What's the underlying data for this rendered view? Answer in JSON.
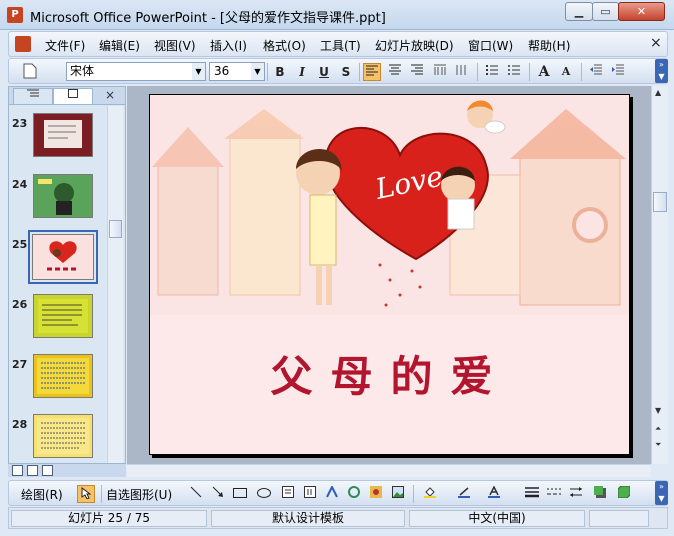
{
  "window": {
    "title": "Microsoft Office PowerPoint - [父母的爱作文指导课件.ppt]",
    "app_icon": "powerpoint-icon",
    "min_symbol": "▁",
    "max_symbol": "▭",
    "close_symbol": "✕"
  },
  "menu": {
    "items": [
      "文件(F)",
      "编辑(E)",
      "视图(V)",
      "插入(I)",
      "格式(O)",
      "工具(T)",
      "幻灯片放映(D)",
      "窗口(W)",
      "帮助(H)"
    ],
    "close_symbol": "×"
  },
  "toolbar": {
    "font": "宋体",
    "size": "36",
    "bold": "B",
    "italic": "I",
    "underline": "U",
    "shadow": "S",
    "grow": "A",
    "shrink": "A"
  },
  "left_pane": {
    "thumbnails": [
      {
        "num": "23",
        "color": "#7b1d22"
      },
      {
        "num": "24",
        "color": "#3a8a3a"
      },
      {
        "num": "25",
        "color": "#fbe0e0"
      },
      {
        "num": "26",
        "color": "#c7d52e"
      },
      {
        "num": "27",
        "color": "#e9c318"
      },
      {
        "num": "28",
        "color": "#f5e070"
      }
    ],
    "close_symbol": "×",
    "selected_index": 2
  },
  "slide": {
    "title": "父母的爱",
    "heart_text": "Love"
  },
  "drawbar": {
    "draw_label": "绘图(R)",
    "autoshape_label": "自选图形(U)"
  },
  "status": {
    "slide": "幻灯片 25 / 75",
    "template": "默认设计模板",
    "language": "中文(中国)"
  }
}
